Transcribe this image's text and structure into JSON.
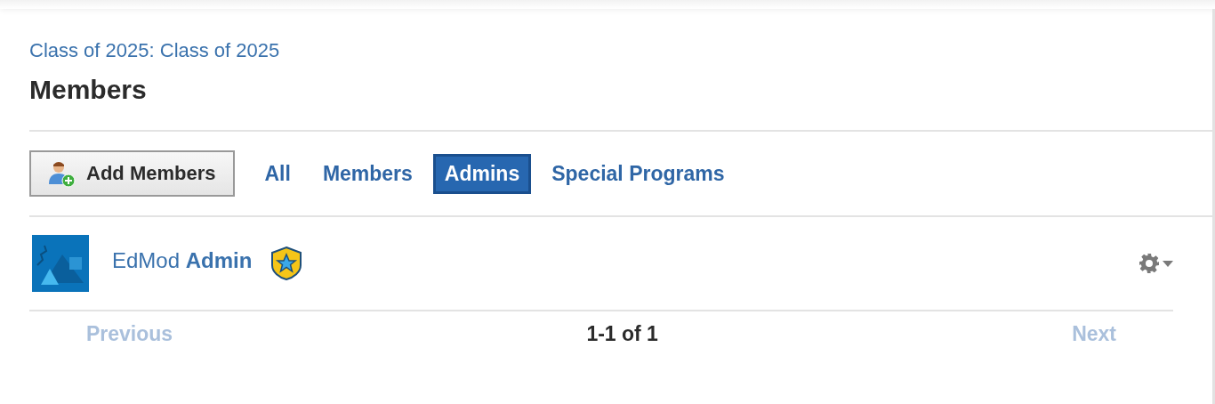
{
  "breadcrumb": "Class of 2025: Class of 2025",
  "title": "Members",
  "add_button": "Add Members",
  "tabs": [
    {
      "label": "All",
      "selected": false
    },
    {
      "label": "Members",
      "selected": false
    },
    {
      "label": "Admins",
      "selected": true
    },
    {
      "label": "Special Programs",
      "selected": false
    }
  ],
  "members": [
    {
      "name": "EdMod **Admin**",
      "admin": true
    }
  ],
  "pagination": {
    "previous": {
      "label": "Previous",
      "disabled": true
    },
    "range": "1-1 of 1",
    "next": {
      "label": "Next",
      "disabled": true
    }
  }
}
